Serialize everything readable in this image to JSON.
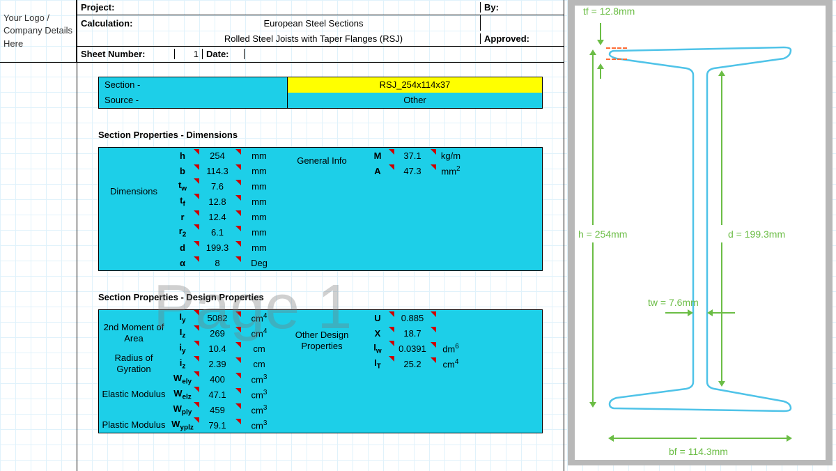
{
  "logo_placeholder": "Your Logo / Company Details Here",
  "header": {
    "project_label": "Project:",
    "calculation_label": "Calculation:",
    "calculation_value": "European Steel Sections",
    "sub_value": "Rolled Steel Joists with Taper Flanges (RSJ)",
    "by_label": "By:",
    "approved_label": "Approved:",
    "sheet_label": "Sheet Number:",
    "sheet_value": "1",
    "date_label": "Date:"
  },
  "select": {
    "section_label": "Section -",
    "section_value": "RSJ_254x114x37",
    "source_label": "Source -",
    "source_value": "Other"
  },
  "title_dim": "Section Properties - Dimensions",
  "dim": {
    "group": "Dimensions",
    "rows": [
      {
        "sym": "h",
        "val": "254",
        "unit": "mm"
      },
      {
        "sym": "b",
        "val": "114.3",
        "unit": "mm"
      },
      {
        "sym": "t<sub>w</sub>",
        "val": "7.6",
        "unit": "mm"
      },
      {
        "sym": "t<sub>f</sub>",
        "val": "12.8",
        "unit": "mm"
      },
      {
        "sym": "r",
        "val": "12.4",
        "unit": "mm"
      },
      {
        "sym": "r<sub>2</sub>",
        "val": "6.1",
        "unit": "mm"
      },
      {
        "sym": "d",
        "val": "199.3",
        "unit": "mm"
      },
      {
        "sym": "α",
        "val": "8",
        "unit": "Deg"
      }
    ],
    "group2": "General Info",
    "rows2": [
      {
        "sym": "M",
        "val": "37.1",
        "unit": "kg/m"
      },
      {
        "sym": "A",
        "val": "47.3",
        "unit": "mm<sup>2</sup>"
      }
    ]
  },
  "title_des": "Section Properties - Design Properties",
  "des": {
    "groups": [
      "2nd Moment of Area",
      "Radius of Gyration",
      "Elastic Modulus",
      "Plastic Modulus"
    ],
    "rows": [
      {
        "sym": "I<sub>y</sub>",
        "val": "5082",
        "unit": "cm<sup>4</sup>"
      },
      {
        "sym": "I<sub>z</sub>",
        "val": "269",
        "unit": "cm<sup>4</sup>"
      },
      {
        "sym": "i<sub>y</sub>",
        "val": "10.4",
        "unit": "cm"
      },
      {
        "sym": "i<sub>z</sub>",
        "val": "2.39",
        "unit": "cm"
      },
      {
        "sym": "W<sub>ely</sub>",
        "val": "400",
        "unit": "cm<sup>3</sup>"
      },
      {
        "sym": "W<sub>elz</sub>",
        "val": "47.1",
        "unit": "cm<sup>3</sup>"
      },
      {
        "sym": "W<sub>ply</sub>",
        "val": "459",
        "unit": "cm<sup>3</sup>"
      },
      {
        "sym": "W<sub>yplz</sub>",
        "val": "79.1",
        "unit": "cm<sup>3</sup>"
      }
    ],
    "group2": "Other Design Properties",
    "rows2": [
      {
        "sym": "U",
        "val": "0.885",
        "unit": ""
      },
      {
        "sym": "X",
        "val": "18.7",
        "unit": ""
      },
      {
        "sym": "I<sub>w</sub>",
        "val": "0.0391",
        "unit": "dm<sup>6</sup>"
      },
      {
        "sym": "I<sub>T</sub>",
        "val": "25.2",
        "unit": "cm<sup>4</sup>"
      }
    ]
  },
  "watermark": "Page 1",
  "diagram": {
    "tf": "tf = 12.8mm",
    "h": "h = 254mm",
    "d": "d = 199.3mm",
    "tw": "tw = 7.6mm",
    "bf": "bf = 114.3mm"
  }
}
